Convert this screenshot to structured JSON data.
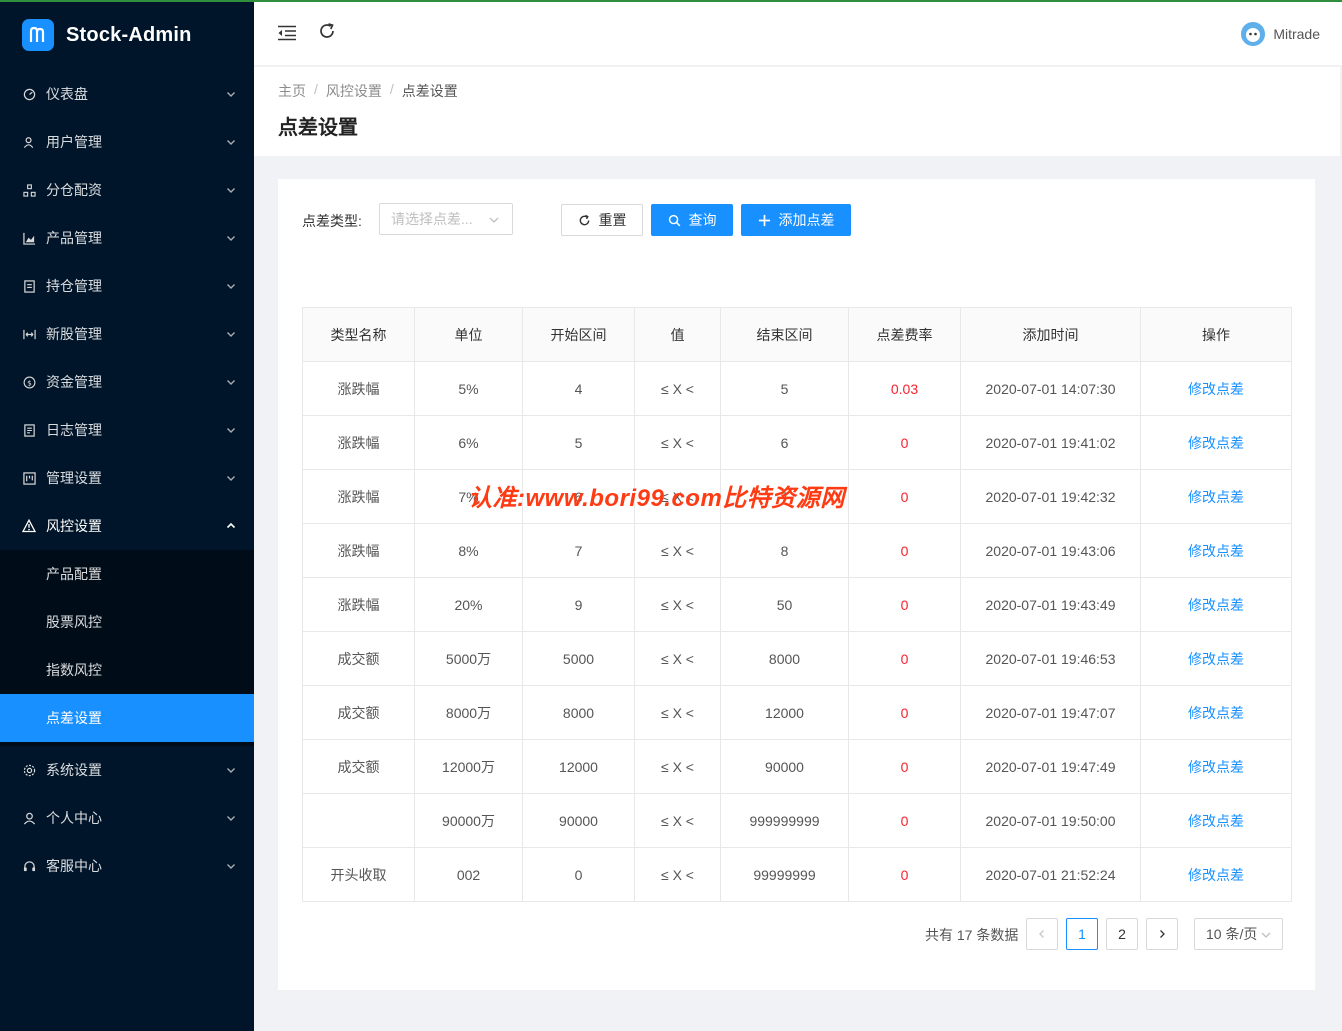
{
  "app": {
    "title": "Stock-Admin",
    "user": "Mitrade"
  },
  "sidebar": {
    "items": [
      {
        "label": "仪表盘",
        "icon": "dashboard-icon"
      },
      {
        "label": "用户管理",
        "icon": "user-group-icon"
      },
      {
        "label": "分仓配资",
        "icon": "cluster-icon"
      },
      {
        "label": "产品管理",
        "icon": "area-chart-icon"
      },
      {
        "label": "持仓管理",
        "icon": "container-icon"
      },
      {
        "label": "新股管理",
        "icon": "column-width-icon"
      },
      {
        "label": "资金管理",
        "icon": "dollar-icon"
      },
      {
        "label": "日志管理",
        "icon": "profile-icon"
      },
      {
        "label": "管理设置",
        "icon": "project-icon"
      },
      {
        "label": "风控设置",
        "icon": "warning-icon",
        "open": true,
        "children": [
          {
            "label": "产品配置"
          },
          {
            "label": "股票风控"
          },
          {
            "label": "指数风控"
          },
          {
            "label": "点差设置",
            "active": true
          }
        ]
      },
      {
        "label": "系统设置",
        "icon": "setting-icon"
      },
      {
        "label": "个人中心",
        "icon": "user-icon"
      },
      {
        "label": "客服中心",
        "icon": "customer-service-icon"
      }
    ]
  },
  "breadcrumb": [
    "主页",
    "风控设置",
    "点差设置"
  ],
  "page_title": "点差设置",
  "filter": {
    "label": "点差类型:",
    "placeholder": "请选择点差...",
    "reset_label": "重置",
    "query_label": "查询",
    "add_label": "添加点差"
  },
  "table": {
    "columns": [
      "类型名称",
      "单位",
      "开始区间",
      "值",
      "结束区间",
      "点差费率",
      "添加时间",
      "操作"
    ],
    "rows": [
      [
        "涨跌幅",
        "5%",
        "4",
        "≤ X <",
        "5",
        "0.03",
        "2020-07-01 14:07:30",
        "修改点差"
      ],
      [
        "涨跌幅",
        "6%",
        "5",
        "≤ X <",
        "6",
        "0",
        "2020-07-01 19:41:02",
        "修改点差"
      ],
      [
        "涨跌幅",
        "7%",
        "6",
        "≤ X <",
        "7",
        "0",
        "2020-07-01 19:42:32",
        "修改点差"
      ],
      [
        "涨跌幅",
        "8%",
        "7",
        "≤ X <",
        "8",
        "0",
        "2020-07-01 19:43:06",
        "修改点差"
      ],
      [
        "涨跌幅",
        "20%",
        "9",
        "≤ X <",
        "50",
        "0",
        "2020-07-01 19:43:49",
        "修改点差"
      ],
      [
        "成交额",
        "5000万",
        "5000",
        "≤ X <",
        "8000",
        "0",
        "2020-07-01 19:46:53",
        "修改点差"
      ],
      [
        "成交额",
        "8000万",
        "8000",
        "≤ X <",
        "12000",
        "0",
        "2020-07-01 19:47:07",
        "修改点差"
      ],
      [
        "成交额",
        "12000万",
        "12000",
        "≤ X <",
        "90000",
        "0",
        "2020-07-01 19:47:49",
        "修改点差"
      ],
      [
        "",
        "90000万",
        "90000",
        "≤ X <",
        "999999999",
        "0",
        "2020-07-01 19:50:00",
        "修改点差"
      ],
      [
        "开头收取",
        "002",
        "0",
        "≤ X <",
        "99999999",
        "0",
        "2020-07-01 21:52:24",
        "修改点差"
      ]
    ]
  },
  "pagination": {
    "total_text": "共有 17 条数据",
    "pages": [
      "1",
      "2"
    ],
    "current": "1",
    "page_size": "10 条/页"
  },
  "watermark": "认准:www.bori99.com比特资源网",
  "colors": {
    "sidebar_bg": "#001529",
    "submenu_bg": "#000c17",
    "primary": "#1890ff",
    "danger": "#f5222d"
  }
}
